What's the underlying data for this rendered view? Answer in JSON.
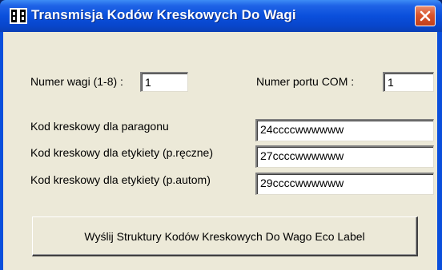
{
  "window": {
    "title": "Transmisja Kodów Kreskowych Do Wagi",
    "app_icon": "scale-app-icon",
    "close_icon": "close-icon",
    "colors": {
      "titlebar": "#0a4fdc",
      "client_bg": "#ece9d8",
      "close_button": "#d9542c"
    }
  },
  "form": {
    "scale_number": {
      "label": "Numer wagi (1-8) :",
      "value": "1"
    },
    "com_port": {
      "label": "Numer portu COM :",
      "value": "1"
    },
    "receipt_barcode": {
      "label": "Kod kreskowy dla paragonu",
      "value": "24ccccwwwwww"
    },
    "label_barcode_manual": {
      "label": "Kod kreskowy dla etykiety (p.ręczne)",
      "value": "27ccccwwwwww"
    },
    "label_barcode_auto": {
      "label": "Kod kreskowy dla etykiety (p.autom)",
      "value": "29ccccwwwwww"
    },
    "send_button": {
      "label": "Wyślij Struktury Kodów Kreskowych Do Wago Eco Label"
    }
  }
}
